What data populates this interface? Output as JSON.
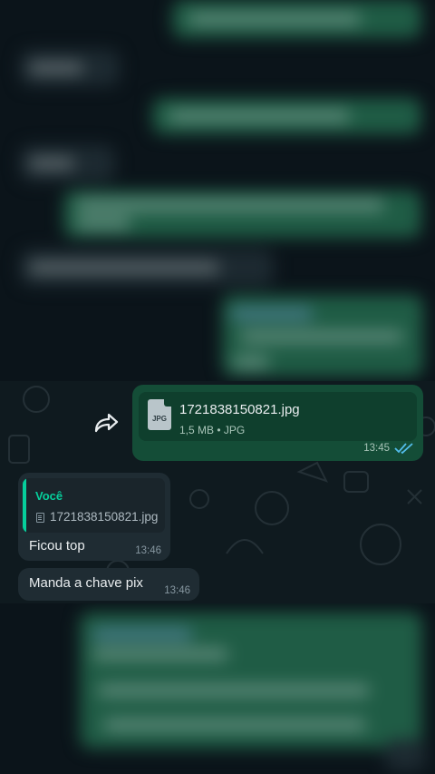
{
  "forwarded_file_message": {
    "file_name": "1721838150821.jpg",
    "file_type_badge": "JPG",
    "file_meta": "1,5 MB • JPG",
    "time": "13:45",
    "status": "read"
  },
  "reply_message": {
    "quoted_author": "Você",
    "quoted_file_name": "1721838150821.jpg",
    "text": "Ficou top",
    "time": "13:46"
  },
  "text_message": {
    "text": "Manda a chave pix",
    "time": "13:46"
  },
  "colors": {
    "background": "#0b141a",
    "outgoing_bubble": "#144d37",
    "incoming_bubble": "#1f2c33",
    "accent_green": "#06cf9c",
    "read_ticks": "#53bdeb"
  }
}
